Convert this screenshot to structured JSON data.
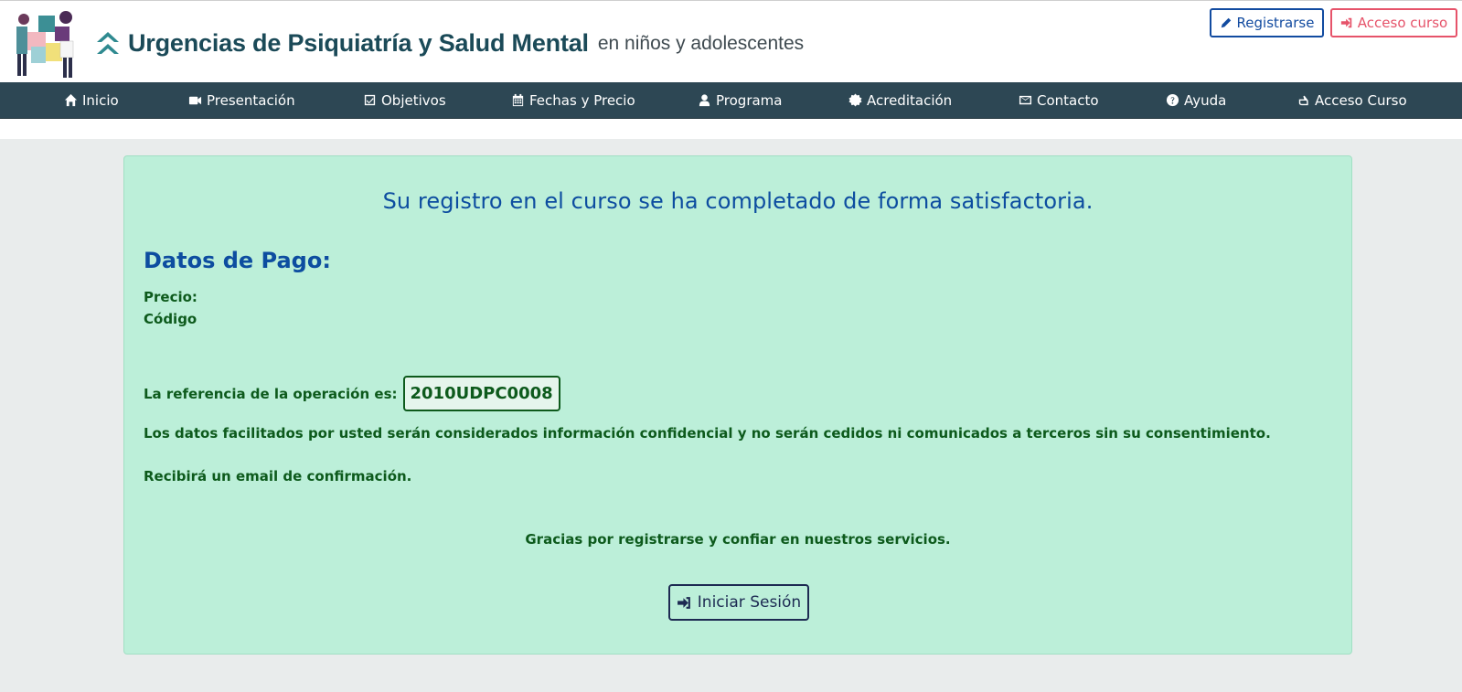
{
  "header": {
    "title": "Urgencias de Psiquiatría y Salud Mental",
    "subtitle": "en niños y adolescentes",
    "register_label": "Registrarse",
    "course_access_label": "Acceso curso"
  },
  "nav": {
    "items": [
      {
        "label": "Inicio",
        "icon": "home-icon"
      },
      {
        "label": "Presentación",
        "icon": "video-icon"
      },
      {
        "label": "Objetivos",
        "icon": "check-square-icon"
      },
      {
        "label": "Fechas y Precio",
        "icon": "calendar-icon"
      },
      {
        "label": "Programa",
        "icon": "user-icon"
      },
      {
        "label": "Acreditación",
        "icon": "certificate-icon"
      },
      {
        "label": "Contacto",
        "icon": "envelope-icon"
      },
      {
        "label": "Ayuda",
        "icon": "question-circle-icon"
      },
      {
        "label": "Acceso Curso",
        "icon": "hand-pointer-icon"
      }
    ]
  },
  "main": {
    "success_message": "Su registro en el curso se ha completado de forma satisfactoria.",
    "payment_title": "Datos de Pago:",
    "price_label": "Precio:",
    "code_label": "Código",
    "reference_label": "La referencia de la operación es:",
    "reference_value": "2010UDPC0008",
    "privacy_text": "Los datos facilitados por usted serán considerados información confidencial y no serán cedidos ni comunicados a terceros sin su consentimiento.",
    "email_text": "Recibirá un email de confirmación.",
    "thanks_text": "Gracias por registrarse y confiar en nuestros servicios.",
    "login_label": "Iniciar Sesión"
  },
  "colors": {
    "nav_bg": "#2d4754",
    "panel_bg": "#bcefd9",
    "title_blue": "#0d4da0",
    "text_green": "#0d5a1c",
    "register_blue": "#124ba0",
    "access_red": "#e6536a"
  }
}
